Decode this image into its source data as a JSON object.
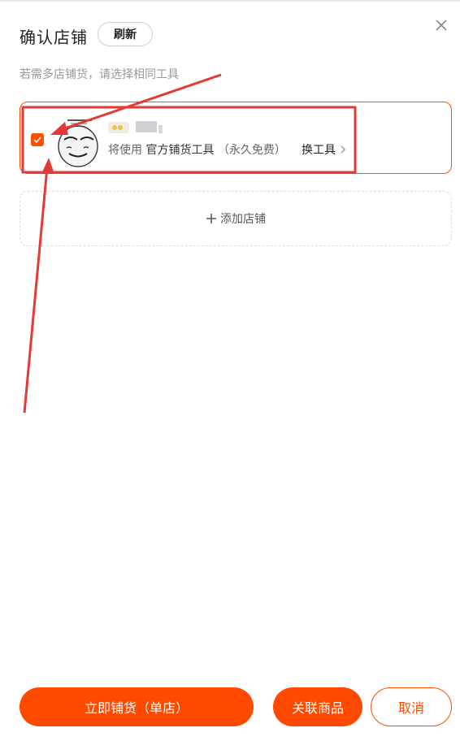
{
  "dialog": {
    "title": "确认店铺",
    "refresh_label": "刷新",
    "hint": "若需多店铺货，请选择相同工具"
  },
  "shop": {
    "checked": true,
    "tool_prefix": "将使用",
    "tool_name": "官方铺货工具",
    "tool_note": "（永久免费）",
    "switch_tool_label": "换工具"
  },
  "add_shop_label": "添加店铺",
  "footer": {
    "primary_label": "立即铺货（单店）",
    "link_label": "关联商品",
    "cancel_label": "取消"
  },
  "colors": {
    "accent": "#ff4a00",
    "annotation": "#e53935"
  },
  "icons": {
    "close": "close-icon",
    "check": "check-icon",
    "chevron": "chevron-right-icon",
    "plus": "plus-icon"
  }
}
